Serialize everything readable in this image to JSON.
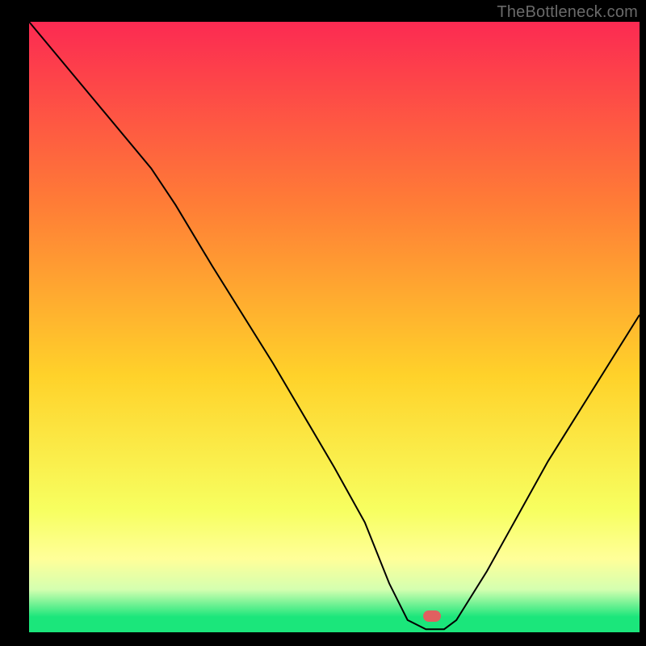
{
  "watermark": "TheBottleneck.com",
  "colors": {
    "background": "#000000",
    "gradient_top": "#fc2a52",
    "gradient_upper_mid": "#ff7d36",
    "gradient_mid": "#ffd22a",
    "gradient_lower_mid": "#f7ff60",
    "gradient_band_yellow": "#ffff99",
    "gradient_band_pale": "#d4ffb0",
    "gradient_bottom": "#1be67b",
    "curve_stroke": "#000000",
    "marker_fill": "#e06060"
  },
  "chart_data": {
    "type": "line",
    "title": "",
    "xlabel": "",
    "ylabel": "",
    "xlim": [
      0,
      100
    ],
    "ylim": [
      0,
      100
    ],
    "series": [
      {
        "name": "bottleneck-curve",
        "x": [
          0,
          10,
          20,
          24,
          30,
          40,
          50,
          55,
          59,
          62,
          65,
          68,
          70,
          75,
          80,
          85,
          90,
          95,
          100
        ],
        "y": [
          100,
          88,
          76,
          70,
          60,
          44,
          27,
          18,
          8,
          2,
          0.5,
          0.5,
          2,
          10,
          19,
          28,
          36,
          44,
          52
        ]
      }
    ],
    "marker": {
      "x": 66,
      "y": 0.5,
      "color": "#e06060"
    },
    "gradient_stops": [
      {
        "pos": 0.0,
        "color": "#fc2a52"
      },
      {
        "pos": 0.3,
        "color": "#ff7d36"
      },
      {
        "pos": 0.58,
        "color": "#ffd22a"
      },
      {
        "pos": 0.8,
        "color": "#f7ff60"
      },
      {
        "pos": 0.88,
        "color": "#ffff99"
      },
      {
        "pos": 0.93,
        "color": "#d4ffb0"
      },
      {
        "pos": 0.975,
        "color": "#1be67b"
      },
      {
        "pos": 1.0,
        "color": "#1be67b"
      }
    ]
  }
}
